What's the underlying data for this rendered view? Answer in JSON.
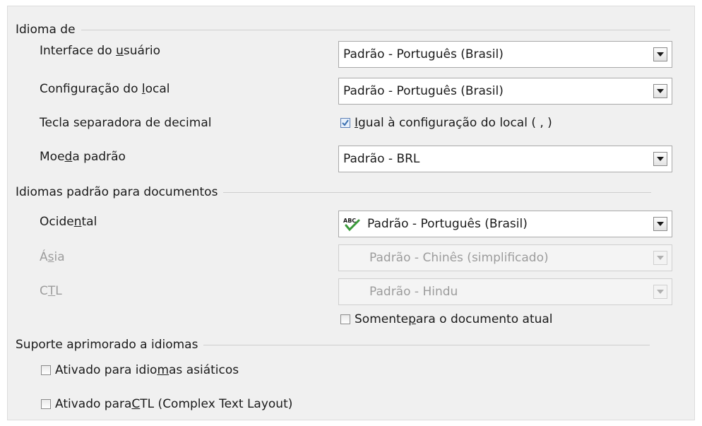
{
  "sections": {
    "idioma_de": "Idioma de",
    "idiomas_padrao": "Idiomas padrão para documentos",
    "suporte": "Suporte aprimorado a idiomas"
  },
  "rows": {
    "interface": {
      "pre": "Interface do ",
      "u": "u",
      "post": "suário",
      "value": "Padrão - Português (Brasil)"
    },
    "config_local": {
      "pre": "Configuração do ",
      "u": "l",
      "post": "ocal",
      "value": "Padrão - Português (Brasil)"
    },
    "decimal": {
      "label": "Tecla separadora de decimal",
      "check_u": "I",
      "check_rest": "gual à configuração do local ( , )",
      "checked": true
    },
    "moeda": {
      "pre": "Moe",
      "u": "d",
      "post": "a padrão",
      "value": "Padrão - BRL"
    },
    "ocidental": {
      "pre": "Ocide",
      "u": "n",
      "post": "tal",
      "value": "Padrão - Português (Brasil)",
      "icon": "abc-spellcheck-icon"
    },
    "asia": {
      "pre": "Á",
      "u": "s",
      "post": "ia",
      "value": "Padrão - Chinês (simplificado)"
    },
    "ctl": {
      "pre": "C",
      "u": "T",
      "post": "L",
      "value": "Padrão - Hindu"
    },
    "somente": {
      "pre": "Somente ",
      "u": "p",
      "post": "ara o documento atual",
      "checked": false
    },
    "asiaticos": {
      "pre": "Ativado para idio",
      "u": "m",
      "post": "as asiáticos",
      "checked": false
    },
    "ctl_layout": {
      "pre": "Ativado para ",
      "u": "C",
      "post": "TL (Complex Text Layout)",
      "checked": false
    }
  },
  "colors": {
    "background": "#f0f0f0",
    "disabled_text": "#9c9c9c",
    "check_accent": "#3a6fb0"
  }
}
